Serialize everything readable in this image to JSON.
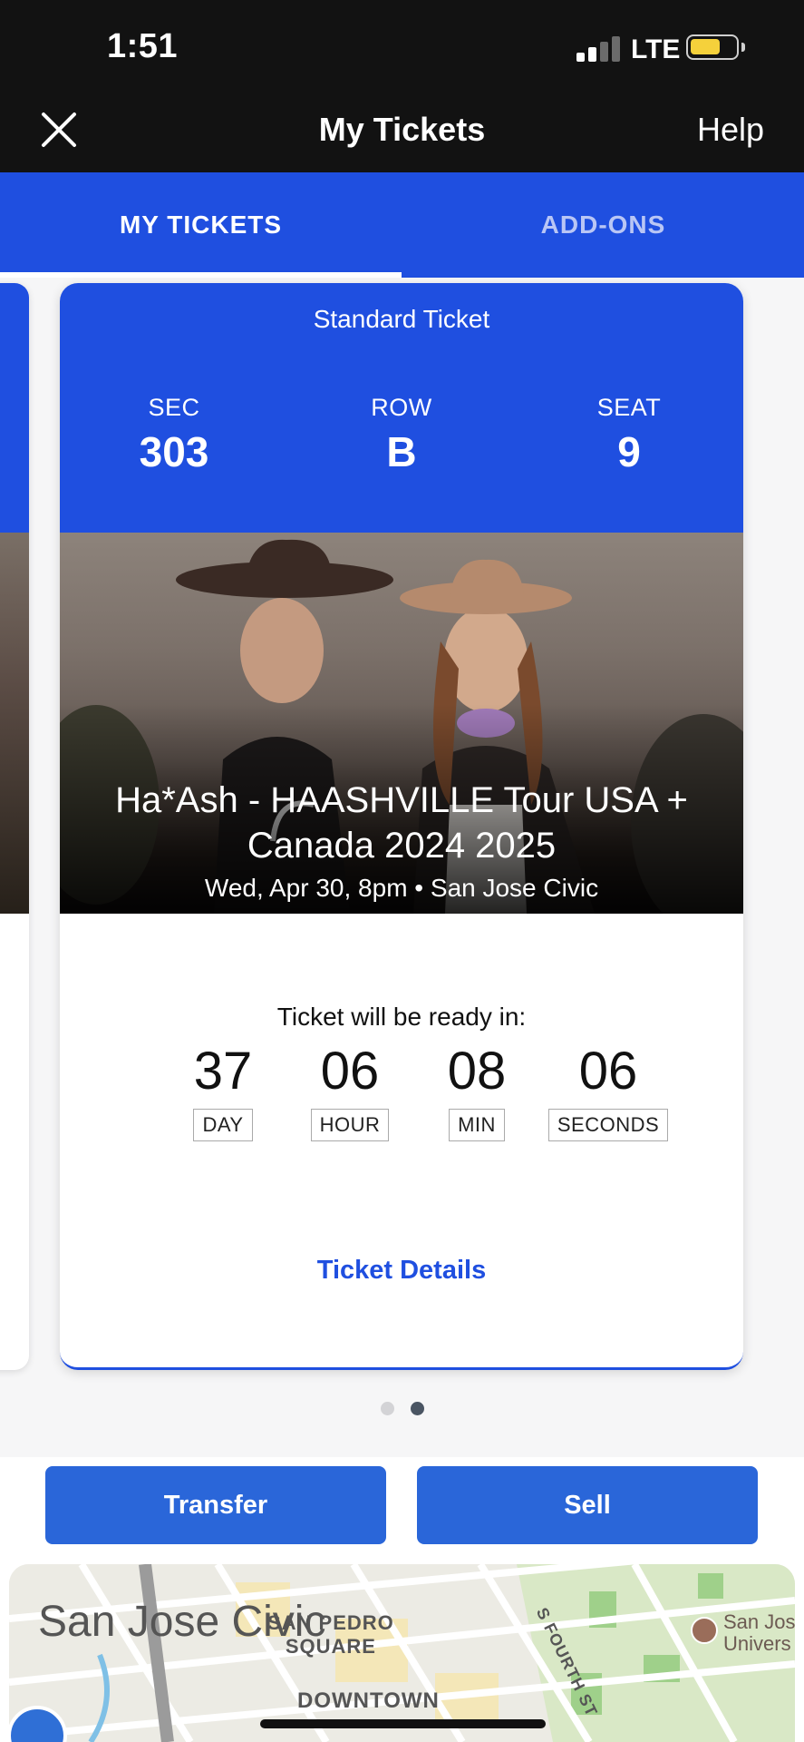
{
  "status_bar": {
    "time": "1:51",
    "network": "LTE"
  },
  "header": {
    "title": "My Tickets",
    "help_label": "Help"
  },
  "tabs": [
    {
      "label": "MY TICKETS",
      "active": true
    },
    {
      "label": "ADD-ONS",
      "active": false
    }
  ],
  "ticket": {
    "type": "Standard Ticket",
    "section_label": "SEC",
    "section": "303",
    "row_label": "ROW",
    "row": "B",
    "seat_label": "SEAT",
    "seat": "9",
    "event_name": "Ha*Ash - HAASHVILLE Tour USA + Canada 2024 2025",
    "event_meta": "Wed, Apr 30, 8pm • San Jose Civic",
    "ready_label": "Ticket will be ready in:",
    "countdown": {
      "days": "37",
      "days_label": "DAY",
      "hours": "06",
      "hours_label": "HOUR",
      "minutes": "08",
      "minutes_label": "MIN",
      "seconds": "06",
      "seconds_label": "SECONDS"
    },
    "details_link": "Ticket Details"
  },
  "pagination": {
    "total": 2,
    "current": 2
  },
  "actions": {
    "transfer_label": "Transfer",
    "sell_label": "Sell"
  },
  "map": {
    "venue_label": "San Jose Civic",
    "area_label_1": "SAN PEDRO",
    "area_label_2": "SQUARE",
    "district_label": "DOWNTOWN",
    "street_label": "S FOURTH ST",
    "poi_label_1": "San Jos",
    "poi_label_2": "Univers"
  },
  "colors": {
    "brand_blue": "#1f4fe0",
    "button_blue": "#2a66d9",
    "header_bg": "#121212"
  }
}
